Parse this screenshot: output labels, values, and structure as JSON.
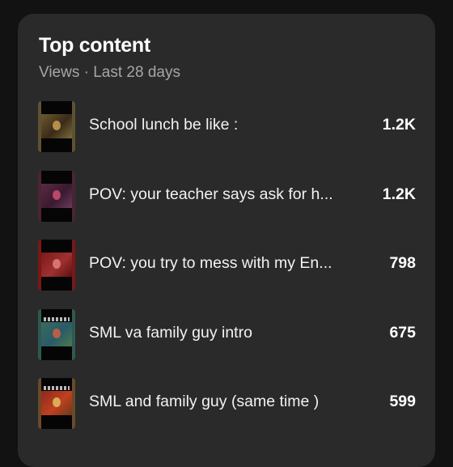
{
  "header": {
    "title": "Top content",
    "subtitle": "Views · Last 28 days"
  },
  "items": [
    {
      "title": "School lunch be like :",
      "value": "1.2K",
      "thumb_colors": [
        "#6b5a2e",
        "#3a2a18",
        "#7a6a3a"
      ],
      "thumb_edge": "#5f5230",
      "thumb_spot": "#c8a050"
    },
    {
      "title": "POV: your teacher says ask for h...",
      "value": "1.2K",
      "thumb_colors": [
        "#5a2a40",
        "#3a1a30",
        "#6a3a5a"
      ],
      "thumb_edge": "#4a2433",
      "thumb_spot": "#d05070"
    },
    {
      "title": "POV: you try to mess with my En...",
      "value": "798",
      "thumb_colors": [
        "#7a1a1a",
        "#a03030",
        "#5a1010"
      ],
      "thumb_edge": "#7a1818",
      "thumb_spot": "#e08080"
    },
    {
      "title": "SML va family guy intro",
      "value": "675",
      "thumb_colors": [
        "#3a6a5a",
        "#2a5a6a",
        "#4a7a4a"
      ],
      "thumb_edge": "#2f5a52",
      "thumb_spot": "#d06040"
    },
    {
      "title": "SML and family guy (same time )",
      "value": "599",
      "thumb_colors": [
        "#8a2a1a",
        "#c04020",
        "#6a3a1a"
      ],
      "thumb_edge": "#6a4a2a",
      "thumb_spot": "#e0c060"
    }
  ]
}
